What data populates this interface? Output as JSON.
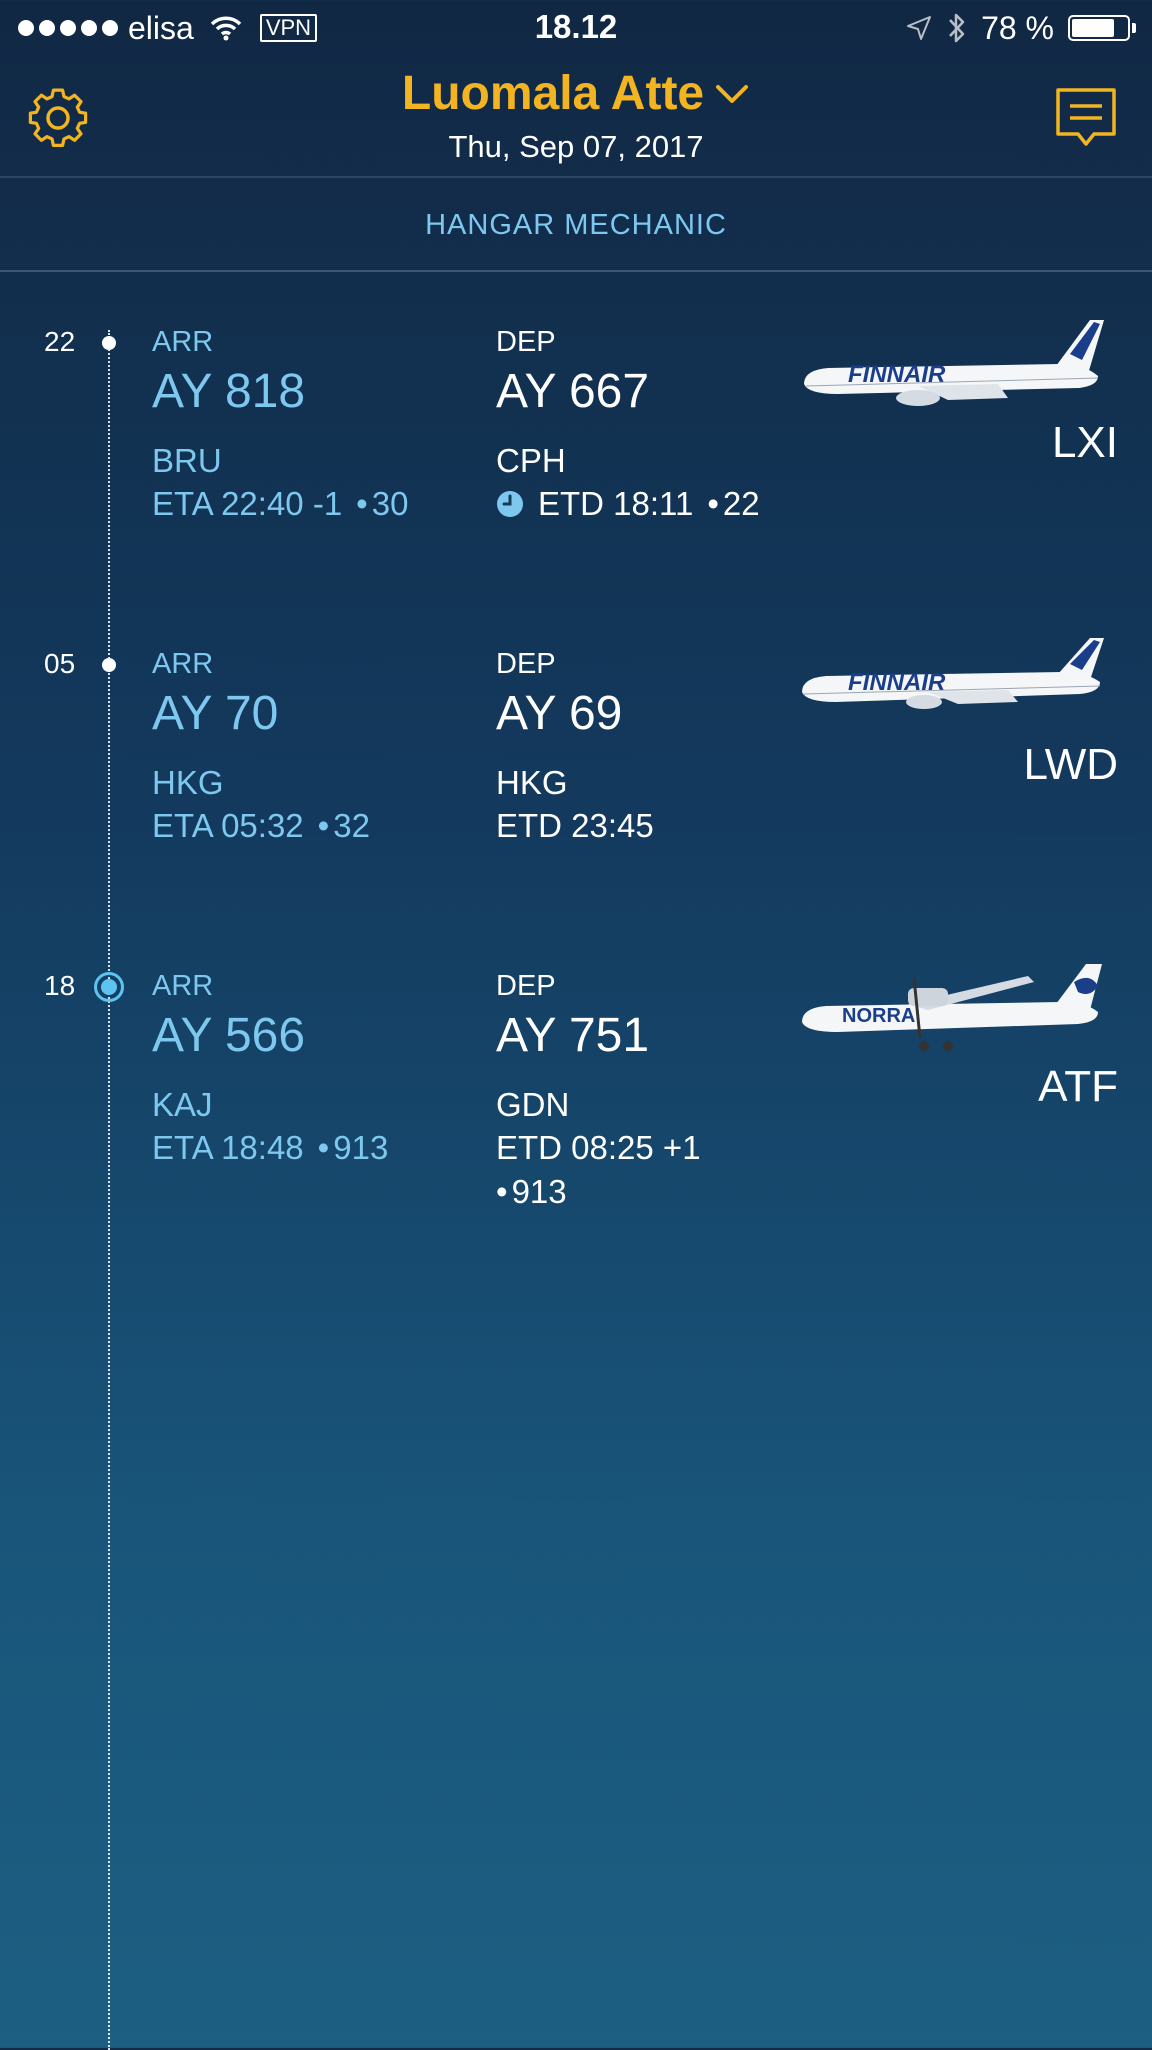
{
  "status_bar": {
    "carrier": "elisa",
    "vpn": "VPN",
    "time": "18.12",
    "battery": "78 %",
    "battery_level": 0.78
  },
  "header": {
    "name": "Luomala Atte",
    "date": "Thu, Sep 07, 2017",
    "settings_icon": "gear-icon",
    "messages_icon": "message-icon",
    "accent_color": "#f2b420"
  },
  "role": "HANGAR MECHANIC",
  "flights": [
    {
      "hour": "22",
      "current": false,
      "arr": {
        "label": "ARR",
        "flight": "AY 818",
        "airport": "BRU",
        "eta": "ETA 22:40 -1",
        "gate": "30"
      },
      "dep": {
        "label": "DEP",
        "flight": "AY 667",
        "airport": "CPH",
        "etd": "ETD 18:11",
        "gate": "22",
        "clock": true
      },
      "aircraft": {
        "registration": "LXI",
        "livery_text": "FINNAIR"
      }
    },
    {
      "hour": "05",
      "current": false,
      "arr": {
        "label": "ARR",
        "flight": "AY 70",
        "airport": "HKG",
        "eta": "ETA 05:32",
        "gate": "32"
      },
      "dep": {
        "label": "DEP",
        "flight": "AY 69",
        "airport": "HKG",
        "etd": "ETD 23:45",
        "gate": "",
        "clock": false
      },
      "aircraft": {
        "registration": "LWD",
        "livery_text": "FINNAIR"
      }
    },
    {
      "hour": "18",
      "current": true,
      "arr": {
        "label": "ARR",
        "flight": "AY 566",
        "airport": "KAJ",
        "eta": "ETA 18:48",
        "gate": "913"
      },
      "dep": {
        "label": "DEP",
        "flight": "AY 751",
        "airport": "GDN",
        "etd": "ETD 08:25 +1",
        "gate": "913",
        "clock": false
      },
      "aircraft": {
        "registration": "ATF",
        "livery_text": "NORRA"
      }
    }
  ]
}
